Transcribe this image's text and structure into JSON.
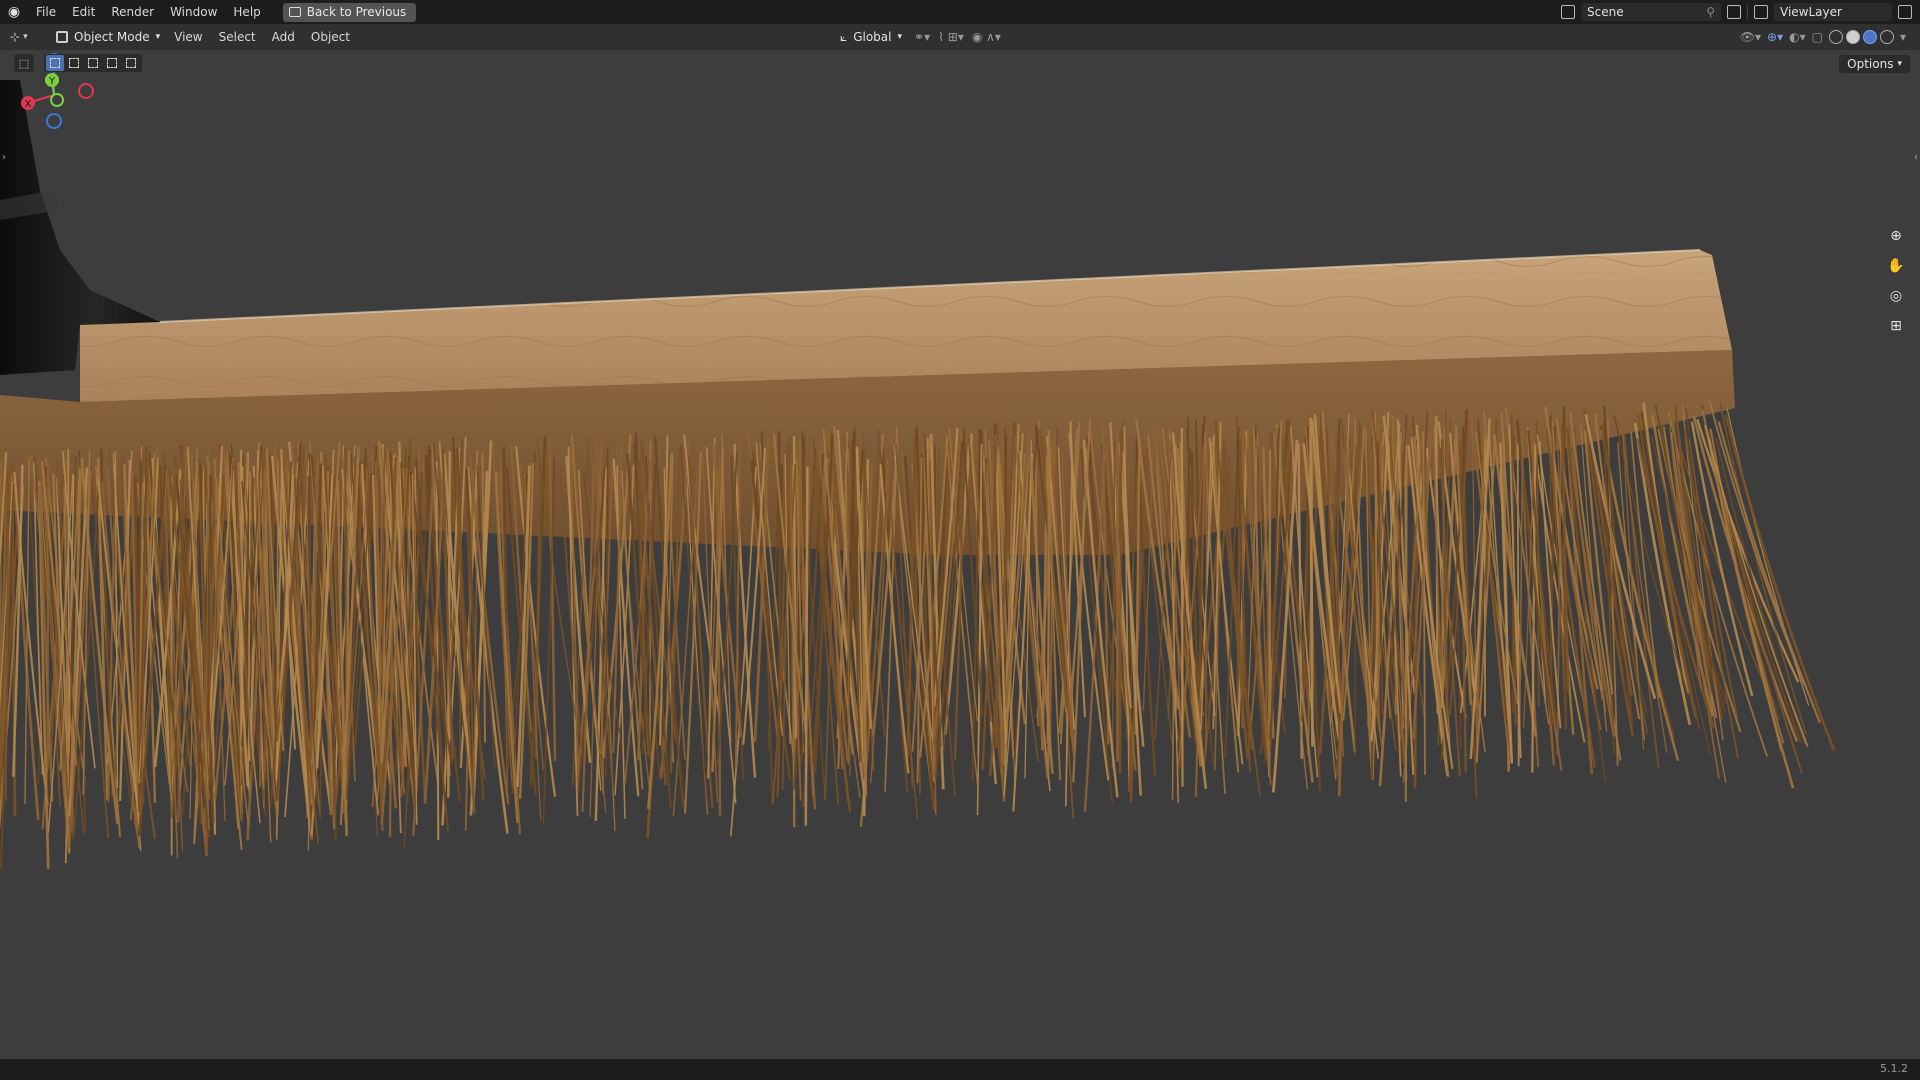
{
  "topbar": {
    "menus": [
      "File",
      "Edit",
      "Render",
      "Window",
      "Help"
    ],
    "back_label": "Back to Previous",
    "scene": "Scene",
    "view_layer": "ViewLayer"
  },
  "header": {
    "mode": "Object Mode",
    "menus": [
      "View",
      "Select",
      "Add",
      "Object"
    ],
    "transform_orientation": "Global"
  },
  "options_label": "Options",
  "gizmo": {
    "x": "X",
    "y": "Y",
    "z": "Z"
  },
  "status": {
    "version": "5.1.2"
  },
  "colors": {
    "accent": "#4772b3",
    "wood": "#a57a4c",
    "bristle": "#8a5e2e",
    "axis_x": "#e0394f",
    "axis_y": "#7bd13a",
    "axis_z": "#3b7ad9"
  },
  "icons": [
    "blender-logo",
    "back-icon",
    "scene-icon",
    "pin-icon",
    "viewlayer-icon",
    "zoom-icon",
    "pan-hand-icon",
    "camera-icon",
    "grid-icon",
    "cursor-tool-icon"
  ]
}
